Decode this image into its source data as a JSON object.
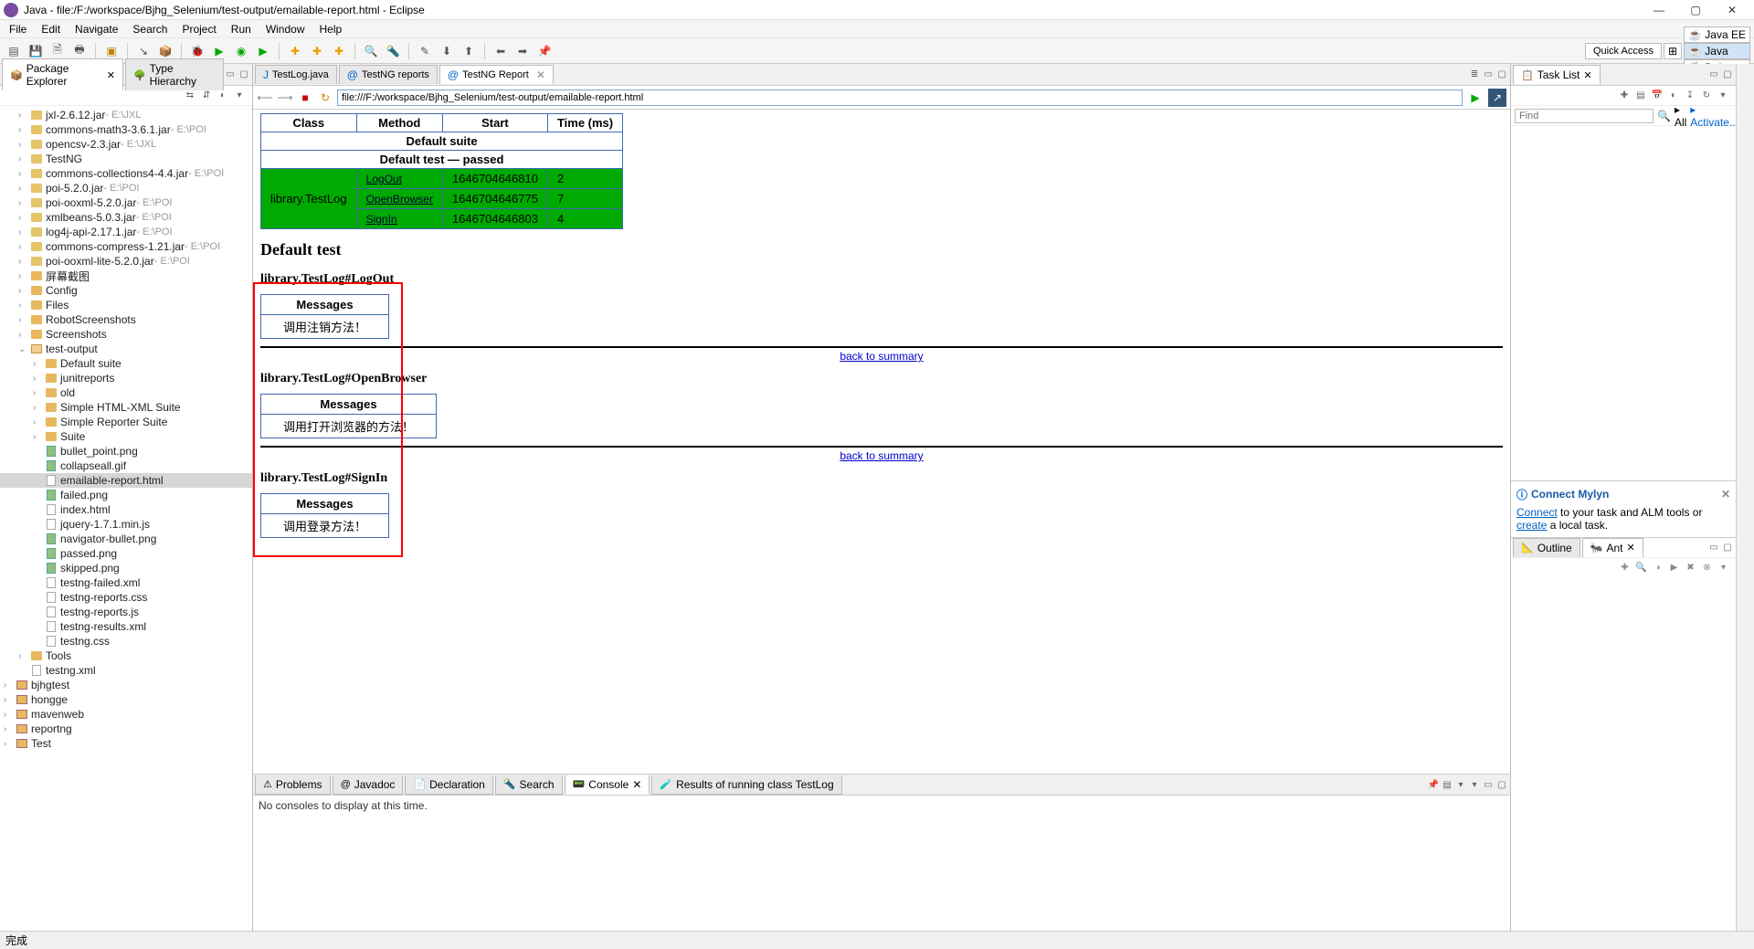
{
  "window": {
    "title": "Java - file:/F:/workspace/Bjhg_Selenium/test-output/emailable-report.html - Eclipse"
  },
  "menu": {
    "items": [
      "File",
      "Edit",
      "Navigate",
      "Search",
      "Project",
      "Run",
      "Window",
      "Help"
    ]
  },
  "quickAccess": "Quick Access",
  "perspectives": [
    {
      "label": "Java EE",
      "icon": "☕"
    },
    {
      "label": "Java",
      "icon": "☕",
      "active": true
    },
    {
      "label": "Debug",
      "icon": "🐞"
    }
  ],
  "leftTabs": {
    "pkg": "Package Explorer",
    "type": "Type Hierarchy"
  },
  "tree": [
    {
      "d": 1,
      "a": ">",
      "ic": "jar",
      "t": "jxl-2.6.12.jar",
      "loc": " - E:\\JXL"
    },
    {
      "d": 1,
      "a": ">",
      "ic": "jar",
      "t": "commons-math3-3.6.1.jar",
      "loc": " - E:\\POI"
    },
    {
      "d": 1,
      "a": ">",
      "ic": "jar",
      "t": "opencsv-2.3.jar",
      "loc": " - E:\\JXL"
    },
    {
      "d": 1,
      "a": ">",
      "ic": "jar",
      "t": "TestNG",
      "loc": ""
    },
    {
      "d": 1,
      "a": ">",
      "ic": "jar",
      "t": "commons-collections4-4.4.jar",
      "loc": " - E:\\POI"
    },
    {
      "d": 1,
      "a": ">",
      "ic": "jar",
      "t": "poi-5.2.0.jar",
      "loc": " - E:\\POI"
    },
    {
      "d": 1,
      "a": ">",
      "ic": "jar",
      "t": "poi-ooxml-5.2.0.jar",
      "loc": " - E:\\POI"
    },
    {
      "d": 1,
      "a": ">",
      "ic": "jar",
      "t": "xmlbeans-5.0.3.jar",
      "loc": " - E:\\POI"
    },
    {
      "d": 1,
      "a": ">",
      "ic": "jar",
      "t": "log4j-api-2.17.1.jar",
      "loc": " - E:\\POI"
    },
    {
      "d": 1,
      "a": ">",
      "ic": "jar",
      "t": "commons-compress-1.21.jar",
      "loc": " - E:\\POI"
    },
    {
      "d": 1,
      "a": ">",
      "ic": "jar",
      "t": "poi-ooxml-lite-5.2.0.jar",
      "loc": " - E:\\POI"
    },
    {
      "d": 1,
      "a": ">",
      "ic": "fld",
      "t": "屏幕截图",
      "loc": ""
    },
    {
      "d": 1,
      "a": ">",
      "ic": "fld",
      "t": "Config",
      "loc": ""
    },
    {
      "d": 1,
      "a": ">",
      "ic": "fld",
      "t": "Files",
      "loc": ""
    },
    {
      "d": 1,
      "a": ">",
      "ic": "fld",
      "t": "RobotScreenshots",
      "loc": ""
    },
    {
      "d": 1,
      "a": ">",
      "ic": "fld",
      "t": "Screenshots",
      "loc": ""
    },
    {
      "d": 1,
      "a": "v",
      "ic": "fld-o",
      "t": "test-output",
      "loc": ""
    },
    {
      "d": 2,
      "a": ">",
      "ic": "fld",
      "t": "Default suite",
      "loc": ""
    },
    {
      "d": 2,
      "a": ">",
      "ic": "fld",
      "t": "junitreports",
      "loc": ""
    },
    {
      "d": 2,
      "a": ">",
      "ic": "fld",
      "t": "old",
      "loc": ""
    },
    {
      "d": 2,
      "a": ">",
      "ic": "fld",
      "t": "Simple HTML-XML Suite",
      "loc": ""
    },
    {
      "d": 2,
      "a": ">",
      "ic": "fld",
      "t": "Simple Reporter Suite",
      "loc": ""
    },
    {
      "d": 2,
      "a": ">",
      "ic": "fld",
      "t": "Suite",
      "loc": ""
    },
    {
      "d": 2,
      "a": "",
      "ic": "img",
      "t": "bullet_point.png",
      "loc": ""
    },
    {
      "d": 2,
      "a": "",
      "ic": "img",
      "t": "collapseall.gif",
      "loc": ""
    },
    {
      "d": 2,
      "a": "",
      "ic": "file",
      "t": "emailable-report.html",
      "loc": "",
      "sel": true
    },
    {
      "d": 2,
      "a": "",
      "ic": "img",
      "t": "failed.png",
      "loc": ""
    },
    {
      "d": 2,
      "a": "",
      "ic": "file",
      "t": "index.html",
      "loc": ""
    },
    {
      "d": 2,
      "a": "",
      "ic": "file",
      "t": "jquery-1.7.1.min.js",
      "loc": ""
    },
    {
      "d": 2,
      "a": "",
      "ic": "img",
      "t": "navigator-bullet.png",
      "loc": ""
    },
    {
      "d": 2,
      "a": "",
      "ic": "img",
      "t": "passed.png",
      "loc": ""
    },
    {
      "d": 2,
      "a": "",
      "ic": "img",
      "t": "skipped.png",
      "loc": ""
    },
    {
      "d": 2,
      "a": "",
      "ic": "file",
      "t": "testng-failed.xml",
      "loc": ""
    },
    {
      "d": 2,
      "a": "",
      "ic": "file",
      "t": "testng-reports.css",
      "loc": ""
    },
    {
      "d": 2,
      "a": "",
      "ic": "file",
      "t": "testng-reports.js",
      "loc": ""
    },
    {
      "d": 2,
      "a": "",
      "ic": "file",
      "t": "testng-results.xml",
      "loc": ""
    },
    {
      "d": 2,
      "a": "",
      "ic": "file",
      "t": "testng.css",
      "loc": ""
    },
    {
      "d": 1,
      "a": ">",
      "ic": "fld",
      "t": "Tools",
      "loc": ""
    },
    {
      "d": 1,
      "a": "",
      "ic": "file",
      "t": "testng.xml",
      "loc": ""
    },
    {
      "d": 0,
      "a": ">",
      "ic": "proj",
      "t": "bjhgtest",
      "loc": ""
    },
    {
      "d": 0,
      "a": ">",
      "ic": "proj",
      "t": "hongge",
      "loc": ""
    },
    {
      "d": 0,
      "a": ">",
      "ic": "proj",
      "t": "mavenweb",
      "loc": ""
    },
    {
      "d": 0,
      "a": ">",
      "ic": "proj",
      "t": "reportng",
      "loc": ""
    },
    {
      "d": 0,
      "a": ">",
      "ic": "proj",
      "t": "Test",
      "loc": ""
    }
  ],
  "editorTabs": [
    {
      "label": "TestLog.java",
      "icon": "J"
    },
    {
      "label": "TestNG reports",
      "icon": "@"
    },
    {
      "label": "TestNG Report",
      "icon": "@",
      "active": true
    }
  ],
  "url": "file:///F:/workspace/Bjhg_Selenium/test-output/emailable-report.html",
  "report": {
    "headers": [
      "Class",
      "Method",
      "Start",
      "Time (ms)"
    ],
    "suite": "Default suite",
    "testPassed": "Default test — passed",
    "rows": [
      {
        "cls": "library.TestLog",
        "m": "LogOut",
        "s": "1646704646810",
        "t": "2"
      },
      {
        "cls": "",
        "m": "OpenBrowser",
        "s": "1646704646775",
        "t": "7"
      },
      {
        "cls": "",
        "m": "SignIn",
        "s": "1646704646803",
        "t": "4"
      }
    ],
    "defaultTest": "Default test",
    "sections": [
      {
        "title": "library.TestLog#LogOut",
        "msgHeader": "Messages",
        "msg": "调用注销方法！",
        "back": "back to summary"
      },
      {
        "title": "library.TestLog#OpenBrowser",
        "msgHeader": "Messages",
        "msg": "调用打开浏览器的方法！",
        "back": "back to summary"
      },
      {
        "title": "library.TestLog#SignIn",
        "msgHeader": "Messages",
        "msg": "调用登录方法！",
        "back": "back to summary"
      }
    ]
  },
  "bottomTabs": {
    "problems": "Problems",
    "javadoc": "Javadoc",
    "declaration": "Declaration",
    "search": "Search",
    "console": "Console",
    "results": "Results of running class TestLog"
  },
  "consoleMsg": "No consoles to display at this time.",
  "taskList": {
    "title": "Task List",
    "find": "Find",
    "all": "All",
    "activate": "Activate..."
  },
  "mylyn": {
    "title": "Connect Mylyn",
    "connect": "Connect",
    "mid": " to your task and ALM tools or ",
    "create": "create",
    "tail": " a local task."
  },
  "outline": {
    "outline": "Outline",
    "ant": "Ant"
  },
  "status": "完成"
}
